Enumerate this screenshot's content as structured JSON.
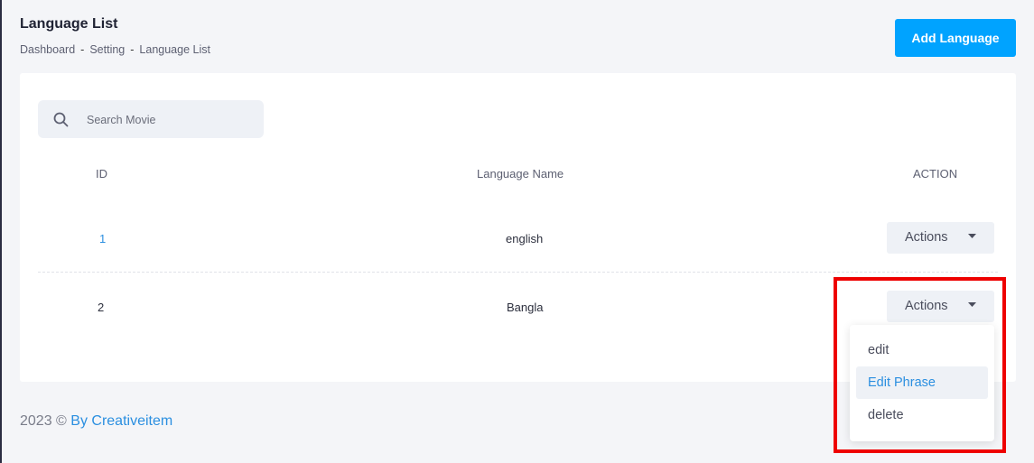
{
  "header": {
    "title": "Language List",
    "breadcrumb": [
      "Dashboard",
      "Setting",
      "Language List"
    ],
    "breadcrumb_sep": "-",
    "add_button": "Add Language"
  },
  "search": {
    "placeholder": "Search Movie",
    "value": ""
  },
  "table": {
    "columns": [
      "ID",
      "Language Name",
      "ACTION"
    ],
    "rows": [
      {
        "id": "1",
        "name": "english",
        "action": "Actions"
      },
      {
        "id": "2",
        "name": "Bangla",
        "action": "Actions"
      }
    ]
  },
  "dropdown": {
    "items": [
      "edit",
      "Edit Phrase",
      "delete"
    ],
    "active_item": "Edit Phrase"
  },
  "footer": {
    "text": "2023 © ",
    "link": "By Creativeitem"
  },
  "colors": {
    "primary": "#00a3ff",
    "link": "#2b8fe0",
    "highlight": "#ee0000",
    "background": "#f4f5f8"
  }
}
